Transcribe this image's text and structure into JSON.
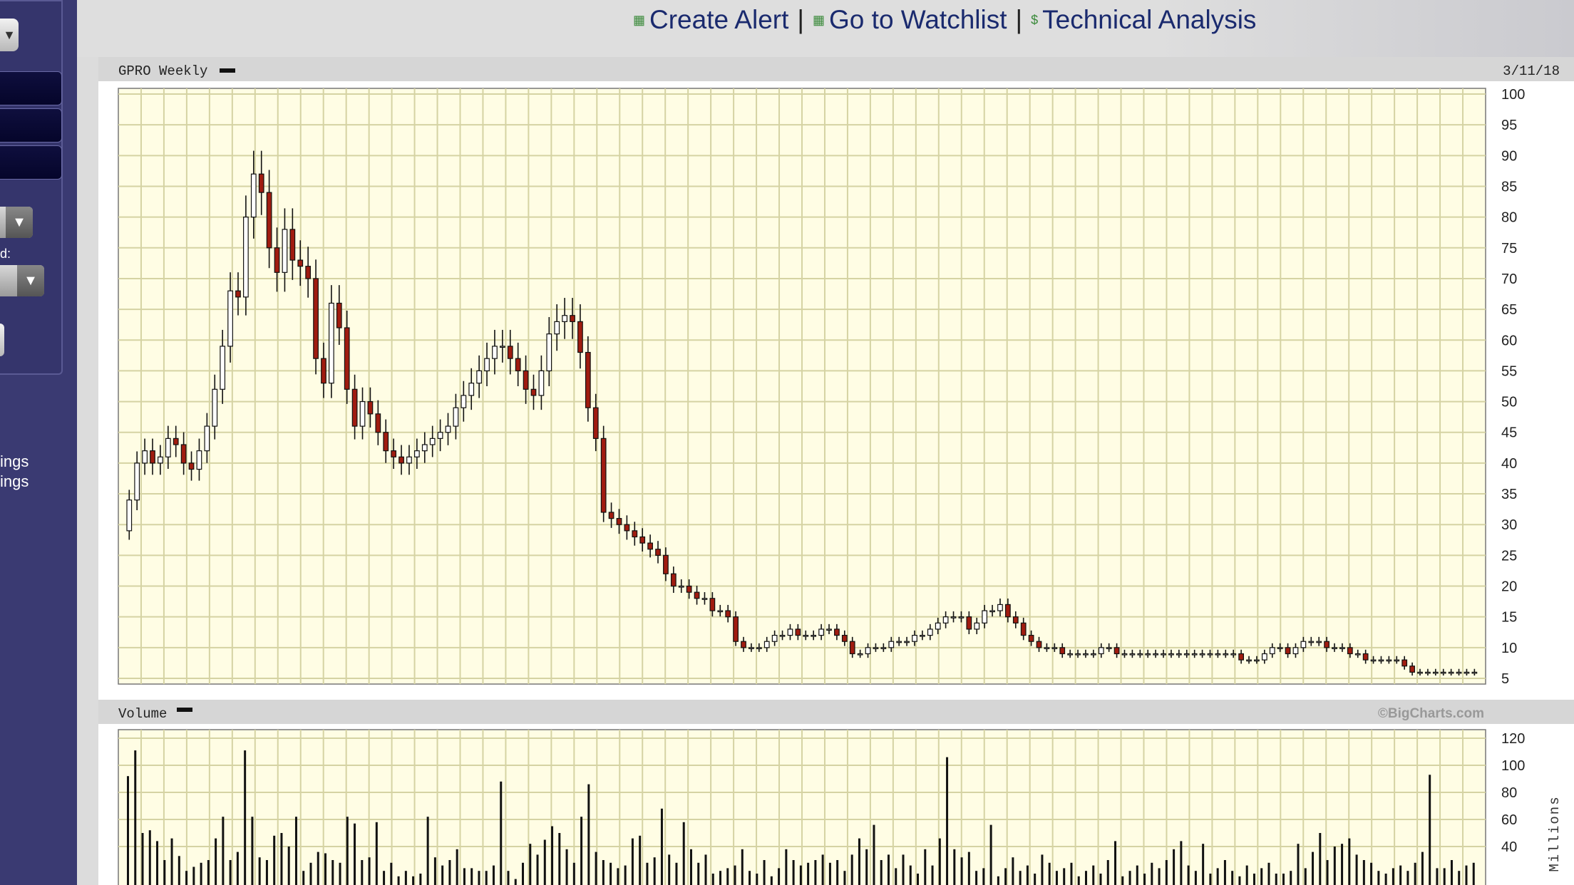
{
  "nav": {
    "create_alert": "Create Alert",
    "watchlist": "Go to Watchlist",
    "technical_analysis": "Technical Analysis",
    "separator": "|",
    "alert_icon": "calculator-icon",
    "watchlist_icon": "calculator-icon",
    "ta_icon": "dollar-icon",
    "dollar_glyph": "$"
  },
  "sidebar": {
    "label_partial": "d:",
    "text_lines": [
      "ings",
      "ings"
    ]
  },
  "chart_data": [
    {
      "type": "candlestick",
      "title": "GPRO Weekly",
      "date": "3/11/18",
      "ylim": [
        5,
        100
      ],
      "y_ticks": [
        5,
        10,
        15,
        20,
        25,
        30,
        35,
        40,
        45,
        50,
        55,
        60,
        65,
        70,
        75,
        80,
        85,
        90,
        95,
        100
      ],
      "grid": true,
      "colors": {
        "up": "#ffffff",
        "down": "#a01c10",
        "plot_bg": "#fffde4",
        "grid": "#d5d3a3"
      },
      "weekly_close": [
        34,
        40,
        42,
        40,
        41,
        44,
        43,
        40,
        39,
        42,
        46,
        52,
        59,
        68,
        67,
        80,
        87,
        84,
        75,
        71,
        78,
        73,
        72,
        70,
        57,
        53,
        66,
        62,
        52,
        46,
        50,
        48,
        45,
        42,
        41,
        40,
        41,
        42,
        43,
        44,
        45,
        46,
        49,
        51,
        53,
        55,
        57,
        59,
        59,
        57,
        55,
        52,
        51,
        55,
        61,
        63,
        64,
        63,
        58,
        49,
        44,
        32,
        31,
        30,
        29,
        28,
        27,
        26,
        25,
        22,
        20,
        20,
        19,
        18,
        18,
        16,
        16,
        15,
        11,
        10,
        10,
        10,
        11,
        12,
        12,
        13,
        12,
        12,
        12,
        13,
        13,
        12,
        11,
        9,
        9,
        10,
        10,
        10,
        11,
        11,
        11,
        12,
        12,
        13,
        14,
        15,
        15,
        15,
        13,
        14,
        16,
        16,
        17,
        15,
        14,
        12,
        11,
        10,
        10,
        10,
        9,
        9,
        9,
        9,
        9,
        10,
        10,
        9,
        9,
        9,
        9,
        9,
        9,
        9,
        9,
        9,
        9,
        9,
        9,
        9,
        9,
        9,
        9,
        8,
        8,
        8,
        9,
        10,
        10,
        9,
        10,
        11,
        11,
        11,
        10,
        10,
        10,
        9,
        9,
        8,
        8,
        8,
        8,
        8,
        7,
        6,
        6,
        6,
        6,
        6,
        6,
        6,
        6,
        6
      ]
    },
    {
      "type": "bar",
      "title": "Volume",
      "ylabel": "Millions",
      "ylim": [
        0,
        120
      ],
      "y_ticks": [
        40,
        60,
        80,
        100,
        120
      ],
      "credit": "©BigCharts.com",
      "weekly_volume": [
        92,
        111,
        50,
        52,
        44,
        30,
        46,
        33,
        22,
        25,
        28,
        30,
        46,
        62,
        30,
        36,
        111,
        62,
        32,
        30,
        48,
        50,
        40,
        62,
        22,
        28,
        36,
        35,
        30,
        28,
        62,
        57,
        30,
        32,
        58,
        22,
        28,
        18,
        22,
        18,
        20,
        62,
        32,
        26,
        30,
        38,
        24,
        24,
        22,
        22,
        26,
        88,
        22,
        16,
        28,
        42,
        34,
        45,
        55,
        50,
        38,
        28,
        62,
        86,
        36,
        30,
        28,
        24,
        26,
        46,
        48,
        28,
        32,
        68,
        34,
        28,
        58,
        38,
        28,
        34,
        20,
        22,
        24,
        26,
        38,
        22,
        20,
        30,
        18,
        24,
        38,
        30,
        26,
        28,
        30,
        34,
        28,
        30,
        22,
        34,
        46,
        38,
        56,
        30,
        34,
        24,
        34,
        26,
        20,
        38,
        26,
        46,
        106,
        38,
        32,
        36,
        22,
        24,
        56,
        18,
        24,
        32,
        22,
        26,
        20,
        34,
        28,
        22,
        24,
        28,
        18,
        22,
        26,
        20,
        30,
        44,
        18,
        22,
        26,
        20,
        28,
        24,
        30,
        38,
        44,
        26,
        22,
        42,
        20,
        24,
        30,
        22,
        18,
        26,
        20,
        24,
        28,
        20,
        20,
        22,
        42,
        24,
        36,
        50,
        30,
        40,
        42,
        46,
        34,
        30,
        28,
        22,
        20,
        24,
        26,
        22,
        28,
        36,
        93,
        24,
        24,
        30,
        22,
        26,
        28
      ]
    }
  ]
}
